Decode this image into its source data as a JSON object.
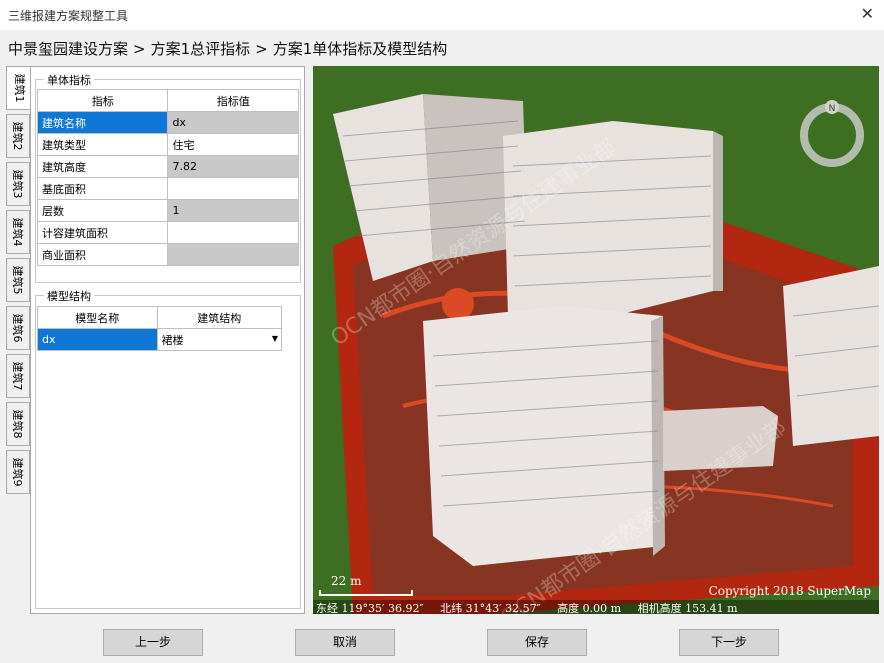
{
  "window": {
    "title": "三维报建方案规整工具",
    "close_glyph": "✕"
  },
  "breadcrumb": [
    "中景玺园建设方案",
    "方案1总评指标",
    "方案1单体指标及模型结构"
  ],
  "breadcrumb_sep": ">",
  "tabs": [
    "建筑1",
    "建筑2",
    "建筑3",
    "建筑4",
    "建筑5",
    "建筑6",
    "建筑7",
    "建筑8",
    "建筑9"
  ],
  "active_tab": 0,
  "indicators": {
    "legend": "单体指标",
    "columns": [
      "指标",
      "指标值"
    ],
    "rows": [
      {
        "name": "建筑名称",
        "value": "dx"
      },
      {
        "name": "建筑类型",
        "value": "住宅"
      },
      {
        "name": "建筑高度",
        "value": "7.82"
      },
      {
        "name": "基底面积",
        "value": ""
      },
      {
        "name": "层数",
        "value": "1"
      },
      {
        "name": "计容建筑面积",
        "value": ""
      },
      {
        "name": "商业面积",
        "value": ""
      }
    ]
  },
  "model_structure": {
    "legend": "模型结构",
    "columns": [
      "模型名称",
      "建筑结构"
    ],
    "rows": [
      {
        "name": "dx",
        "structure": "裙楼"
      }
    ]
  },
  "map": {
    "scale_label": "22 m",
    "copyright": "Copyright 2018 SuperMap",
    "longitude": "东经 119°35′ 36.92″",
    "latitude": "北纬 31°43′ 32.57″",
    "altitude": "高度 0.00 m",
    "camera_height": "相机高度 153.41 m",
    "compass_label": "N",
    "watermark": "OCN都市圈·自然资源与住建事业部"
  },
  "buttons": {
    "prev": "上一步",
    "cancel": "取消",
    "save": "保存",
    "next": "下一步"
  },
  "colors": {
    "selection": "#0f78d7",
    "readonly": "#c8c8c8",
    "ground": "#3e6e21",
    "site": "#b3260f"
  }
}
